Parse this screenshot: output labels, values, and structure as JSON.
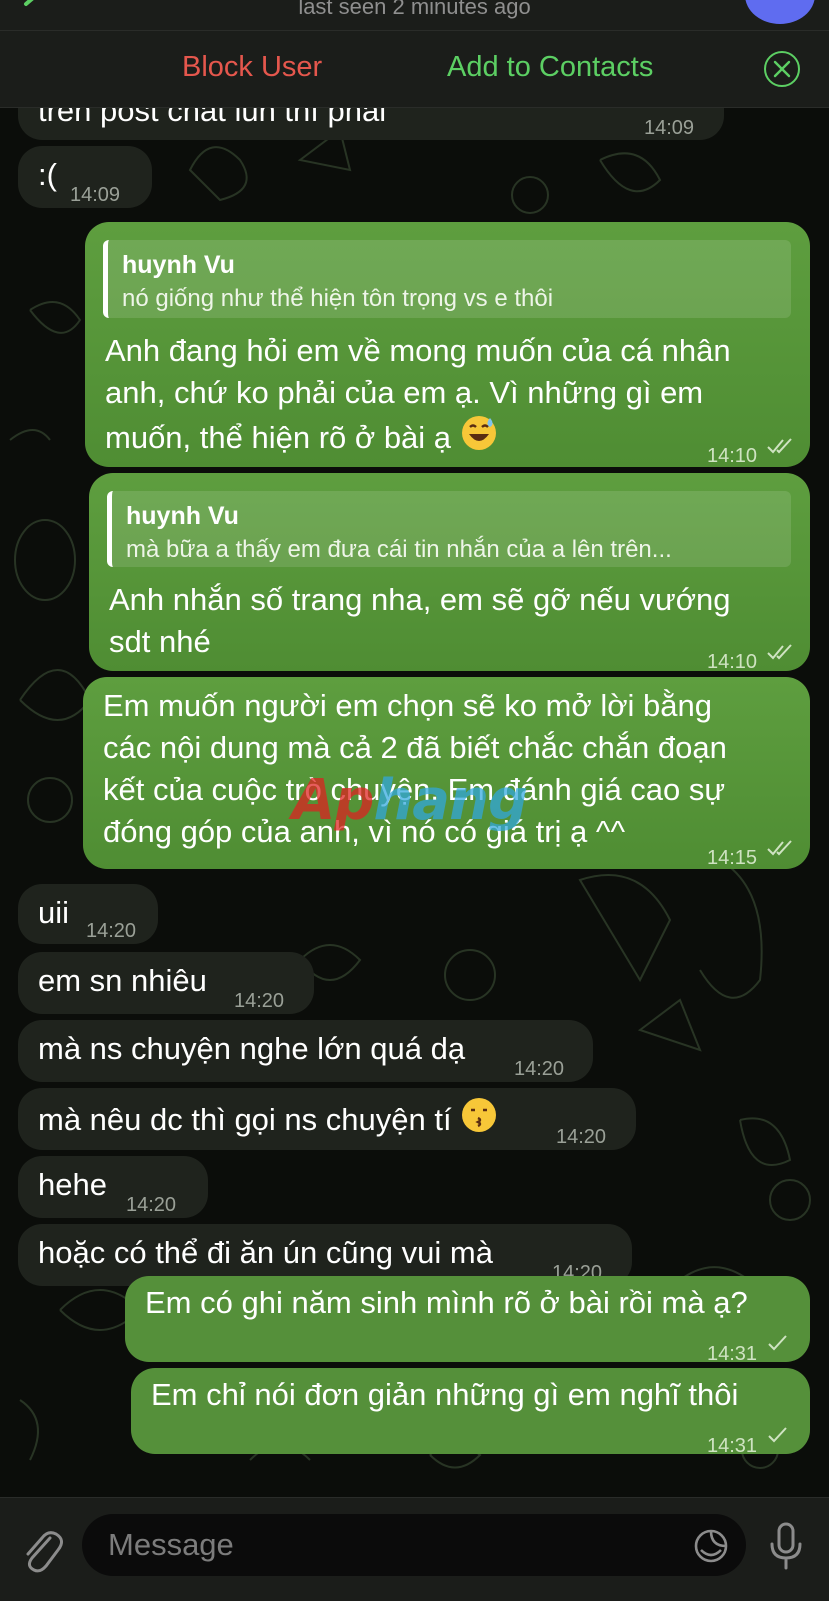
{
  "header": {
    "status": "last seen 2 minutes ago"
  },
  "actions": {
    "block_user": "Block User",
    "add_to_contacts": "Add to Contacts"
  },
  "messages": [
    {
      "direction": "in",
      "text": "trên post chat lun thì phải",
      "time": "14:09"
    },
    {
      "direction": "in",
      "text": ":(",
      "time": "14:09"
    },
    {
      "direction": "out",
      "reply_name": "huynh Vu",
      "reply_text": "nó giống như thể hiện tôn trọng vs e thôi",
      "lines": [
        "Anh đang hỏi em về mong muốn của cá nhân",
        "anh, chứ ko phải của em ạ. Vì những gì em",
        "muốn, thể hiện rõ ở bài ạ"
      ],
      "emoji": "grinning-sweat-emoji",
      "time": "14:10",
      "status": "read"
    },
    {
      "direction": "out",
      "reply_name": "huynh Vu",
      "reply_text": "mà bữa a thấy em đưa cái tin nhắn của a lên trên...",
      "lines": [
        "Anh nhắn số trang nha, em sẽ gỡ nếu vướng",
        "sdt nhé"
      ],
      "time": "14:10",
      "status": "read"
    },
    {
      "direction": "out",
      "lines": [
        "Em muốn người em chọn sẽ ko mở lời bằng",
        "các nội dung mà cả 2 đã biết chắc chắn đoạn",
        "kết của cuộc trò chuyện. Em đánh giá cao sự",
        "đóng góp của anh, vì nó có giá trị ạ ^^"
      ],
      "time": "14:15",
      "status": "read"
    },
    {
      "direction": "in",
      "text": "uii",
      "time": "14:20"
    },
    {
      "direction": "in",
      "text": "em sn nhiêu",
      "time": "14:20"
    },
    {
      "direction": "in",
      "text": "mà ns chuyện nghe lớn quá dạ",
      "time": "14:20"
    },
    {
      "direction": "in",
      "text": "mà nêu dc thì gọi ns chuyện tí",
      "emoji": "kissing-emoji",
      "time": "14:20"
    },
    {
      "direction": "in",
      "text": "hehe",
      "time": "14:20"
    },
    {
      "direction": "in",
      "text": "hoặc có thể đi ăn ún cũng vui mà",
      "time": "14:20"
    },
    {
      "direction": "out",
      "text": "Em có ghi năm sinh mình rõ ở bài rồi mà ạ?",
      "time": "14:31",
      "status": "sent"
    },
    {
      "direction": "out",
      "text": "Em chỉ nói đơn giản những gì em nghĩ thôi",
      "time": "14:31",
      "status": "sent"
    }
  ],
  "watermark": {
    "part1": "Ap",
    "part2": "hang"
  },
  "composer": {
    "placeholder": "Message"
  },
  "colors": {
    "block": "#e5574d",
    "accent_green": "#5ccf63",
    "outgoing_bubble": "#4f8d33",
    "incoming_bubble": "#1f231d"
  }
}
